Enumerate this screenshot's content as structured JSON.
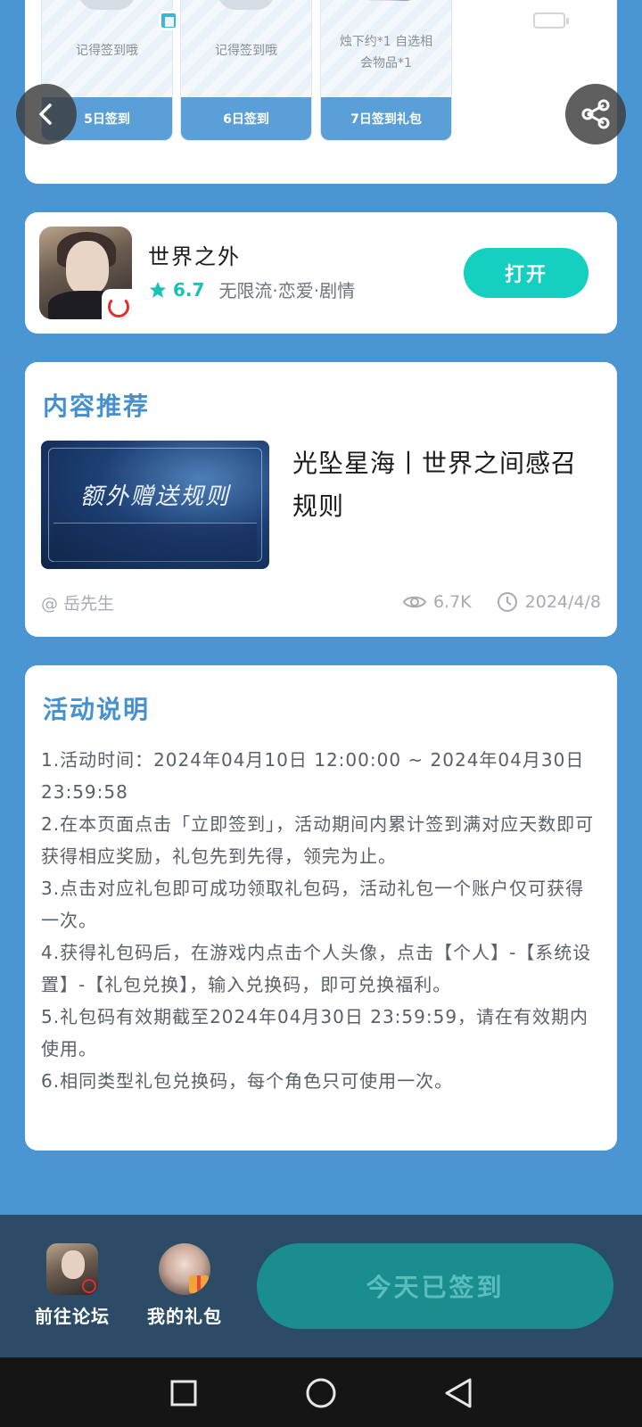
{
  "checkin": {
    "tiles": [
      {
        "text_lines": [
          "记得签到哦"
        ],
        "footer": "5日签到"
      },
      {
        "text_lines": [
          "记得签到哦"
        ],
        "footer": "6日签到"
      },
      {
        "text_lines": [
          "烛下约*1 自选相",
          "会物品*1"
        ],
        "footer": "7日签到礼包"
      }
    ]
  },
  "float_buttons": {
    "back_icon": "chevron-left-icon",
    "share_icon": "share-icon"
  },
  "game": {
    "title": "世界之外",
    "rating": "6.7",
    "tags": "无限流·恋爱·剧情",
    "open_label": "打开"
  },
  "content": {
    "section_title": "内容推荐",
    "article": {
      "thumb_title": "额外赠送规则",
      "title": "光坠星海丨世界之间感召规则",
      "author": "@ 岳先生",
      "views": "6.7K",
      "date": "2024/4/8"
    }
  },
  "activity": {
    "section_title": "活动说明",
    "rules": [
      "1.活动时间：2024年04月10日 12:00:00 ~ 2024年04月30日 23:59:58",
      "2.在本页面点击「立即签到」，活动期间内累计签到满对应天数即可获得相应奖励，礼包先到先得，领完为止。",
      "3.点击对应礼包即可成功领取礼包码，活动礼包一个账户仅可获得一次。",
      "4.获得礼包码后，在游戏内点击个人头像，点击【个人】-【系统设置】-【礼包兑换】，输入兑换码，即可兑换福利。",
      "5.礼包码有效期截至2024年04月30日 23:59:59，请在有效期内使用。",
      "6.相同类型礼包兑换码，每个角色只可使用一次。"
    ]
  },
  "bottom_bar": {
    "forum_label": "前往论坛",
    "gifts_label": "我的礼包",
    "checked_label": "今天已签到"
  },
  "colors": {
    "background": "#4a96d2",
    "accent_teal": "#15cfc0",
    "section_blue": "#4590cf",
    "bottom_bar": "#2b4b67"
  }
}
